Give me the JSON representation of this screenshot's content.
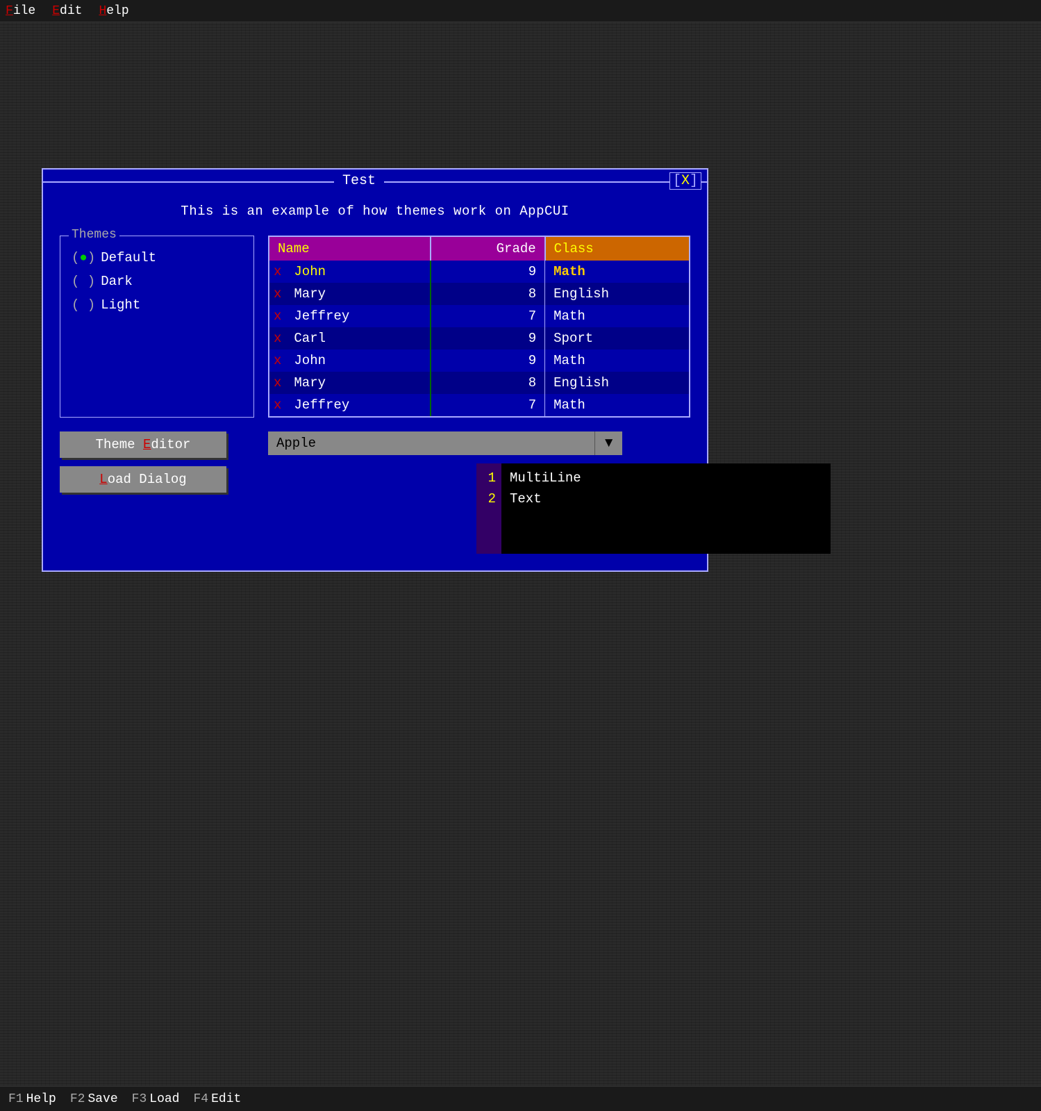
{
  "menubar": {
    "items": [
      {
        "label": "File",
        "underline_char": "F",
        "rest": "ile"
      },
      {
        "label": "Edit",
        "underline_char": "E",
        "rest": "dit"
      },
      {
        "label": "Help",
        "underline_char": "H",
        "rest": "elp"
      }
    ]
  },
  "dialog": {
    "title": "Test",
    "close_label": "[X]",
    "subtitle": "This is an example of how themes work on AppCUI",
    "themes_panel_title": "Themes",
    "themes": [
      {
        "label": "Default",
        "selected": true
      },
      {
        "label": "Dark",
        "selected": false
      },
      {
        "label": "Light",
        "selected": false
      }
    ],
    "table": {
      "headers": [
        "Name",
        "Grade",
        "Class"
      ],
      "rows": [
        {
          "name": "John",
          "grade": "9",
          "class": "Math"
        },
        {
          "name": "Mary",
          "grade": "8",
          "class": "English"
        },
        {
          "name": "Jeffrey",
          "grade": "7",
          "class": "Math"
        },
        {
          "name": "Carl",
          "grade": "9",
          "class": "Sport"
        },
        {
          "name": "John",
          "grade": "9",
          "class": "Math"
        },
        {
          "name": "Mary",
          "grade": "8",
          "class": "English"
        },
        {
          "name": "Jeffrey",
          "grade": "7",
          "class": "Math"
        }
      ]
    },
    "dropdown_value": "Apple",
    "dropdown_arrow": "▼",
    "editor_lines": [
      {
        "num": "1",
        "text": "MultiLine"
      },
      {
        "num": "2",
        "text": "Text"
      }
    ],
    "buttons": [
      {
        "label": "Theme Editor",
        "underline": "E",
        "before": "Theme ",
        "after": "ditor"
      },
      {
        "label": "Load Dialog",
        "underline": "L",
        "before": "",
        "after": "oad Dialog"
      }
    ]
  },
  "statusbar": {
    "items": [
      {
        "key": "F1",
        "label": "Help"
      },
      {
        "key": "F2",
        "label": "Save"
      },
      {
        "key": "F3",
        "label": "Load"
      },
      {
        "key": "F4",
        "label": "Edit"
      }
    ]
  }
}
